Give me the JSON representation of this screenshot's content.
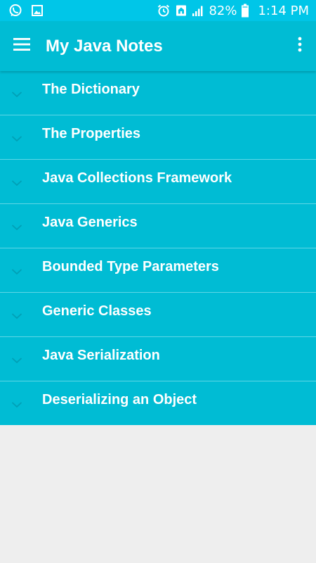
{
  "status_bar": {
    "left_icons": [
      "whatsapp-icon",
      "gallery-icon"
    ],
    "right_icons": [
      "alarm-icon",
      "home-icon",
      "signal-icon",
      "battery-icon"
    ],
    "battery_percent": "82%",
    "time": "1:14 PM"
  },
  "app_bar": {
    "title": "My Java Notes",
    "menu_icon": "hamburger-menu-icon",
    "overflow_icon": "overflow-menu-icon"
  },
  "colors": {
    "status_bar": "#00c6e8",
    "app_bar": "#00bcd4",
    "list_background": "#00bcd4",
    "divider": "#5fd6e6",
    "page_background": "#eeeeee",
    "text": "#ffffff"
  },
  "topics": [
    {
      "label": "The Dictionary",
      "icon": "chevron-down-icon"
    },
    {
      "label": "The Properties",
      "icon": "chevron-down-icon"
    },
    {
      "label": "Java Collections Framework",
      "icon": "chevron-down-icon"
    },
    {
      "label": "Java Generics",
      "icon": "chevron-down-icon"
    },
    {
      "label": "Bounded Type Parameters",
      "icon": "chevron-down-icon"
    },
    {
      "label": "Generic Classes",
      "icon": "chevron-down-icon"
    },
    {
      "label": "Java Serialization",
      "icon": "chevron-down-icon"
    },
    {
      "label": "Deserializing an Object",
      "icon": "chevron-down-icon"
    }
  ]
}
